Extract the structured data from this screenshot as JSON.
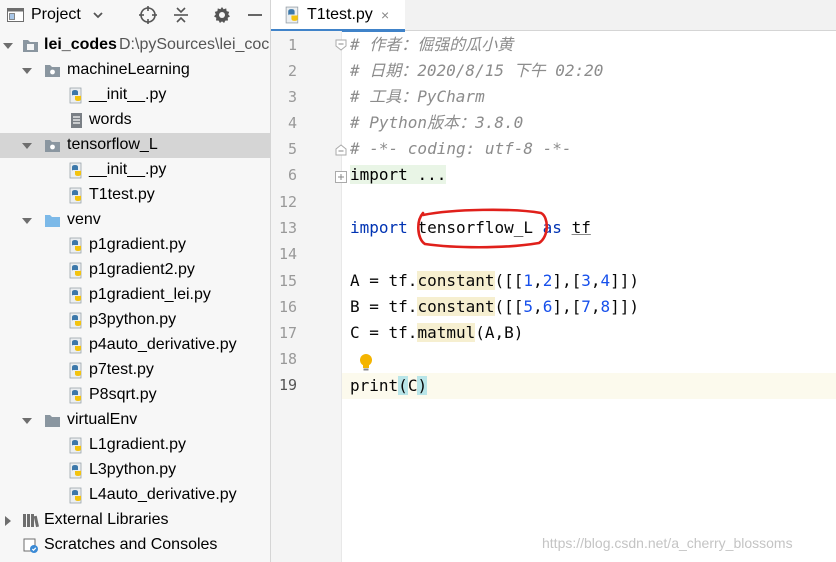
{
  "project_pane": {
    "title": "Project",
    "tree": [
      {
        "label": "lei_codes",
        "path": "D:\\pySources\\lei_coc",
        "kind": "project-root",
        "expanded": true
      },
      {
        "label": "machineLearning",
        "kind": "folder",
        "expanded": true
      },
      {
        "label": "__init__.py",
        "kind": "python-file"
      },
      {
        "label": "words",
        "kind": "text-file"
      },
      {
        "label": "tensorflow_L",
        "kind": "folder",
        "expanded": true,
        "selected": true
      },
      {
        "label": "__init__.py",
        "kind": "python-file"
      },
      {
        "label": "T1test.py",
        "kind": "python-file"
      },
      {
        "label": "venv",
        "kind": "folder",
        "expanded": true
      },
      {
        "label": "p1gradient.py",
        "kind": "python-file"
      },
      {
        "label": "p1gradient2.py",
        "kind": "python-file"
      },
      {
        "label": "p1gradient_lei.py",
        "kind": "python-file"
      },
      {
        "label": "p3python.py",
        "kind": "python-file"
      },
      {
        "label": "p4auto_derivative.py",
        "kind": "python-file"
      },
      {
        "label": "p7test.py",
        "kind": "python-file"
      },
      {
        "label": "P8sqrt.py",
        "kind": "python-file"
      },
      {
        "label": "virtualEnv",
        "kind": "folder",
        "expanded": true
      },
      {
        "label": "L1gradient.py",
        "kind": "python-file"
      },
      {
        "label": "L3python.py",
        "kind": "python-file"
      },
      {
        "label": "L4auto_derivative.py",
        "kind": "python-file"
      },
      {
        "label": "External Libraries",
        "kind": "libraries",
        "expanded": false
      },
      {
        "label": "Scratches and Consoles",
        "kind": "scratches"
      }
    ]
  },
  "editor": {
    "tab": {
      "label": "T1test.py",
      "close": "×"
    },
    "line_numbers": [
      "1",
      "2",
      "3",
      "4",
      "5",
      "6",
      "12",
      "13",
      "14",
      "15",
      "16",
      "17",
      "18",
      "19"
    ],
    "code": {
      "l1": "# 作者：倔强的瓜小黄",
      "l2": "# 日期：2020/8/15 下午 02:20",
      "l3": "# 工具：PyCharm",
      "l4": "# Python版本：3.8.0",
      "l5": "# -*- coding: utf-8 -*-",
      "l6_kw": "import",
      "l6_fold": "...",
      "l13_kw1": "import",
      "l13_module": "tensorflow_L",
      "l13_kw2": "as",
      "l13_alias": "tf",
      "l15_lhs": "A = tf.",
      "l15_fn": "constant",
      "l15_open": "([[",
      "l15_n1": "1",
      "l15_n2": "2",
      "l15_n3": "3",
      "l15_n4": "4",
      "l16_lhs": "B = tf.",
      "l16_fn": "constant",
      "l16_n1": "5",
      "l16_n2": "6",
      "l16_n3": "7",
      "l16_n4": "8",
      "l17_lhs": "C = tf.",
      "l17_fn": "matmul",
      "l17_args": "(A,B)",
      "l19_fn": "print",
      "l19_arg": "C"
    }
  },
  "watermark": "https://blog.csdn.net/a_cherry_blossoms",
  "colors": {
    "keyword": "#0033b3",
    "comment": "#8c8c8c",
    "number": "#1750eb",
    "tab_accent": "#4083c9",
    "annotation_circle": "#e0201b",
    "selection": "#d5d5d5"
  }
}
